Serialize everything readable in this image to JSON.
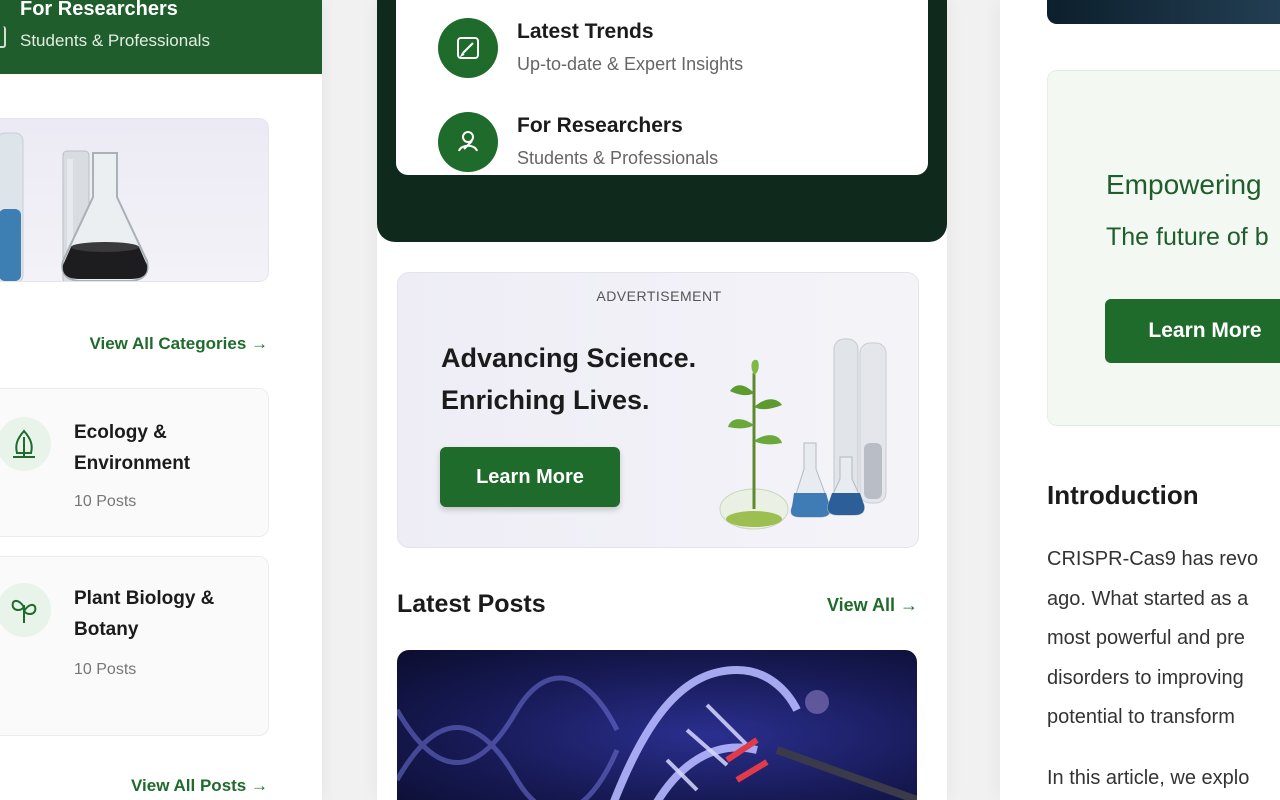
{
  "left": {
    "banner": {
      "title": "For Researchers",
      "subtitle": "Students & Professionals"
    },
    "view_all_categories": "View All Categories →",
    "categories": [
      {
        "title": "Ecology & Environment",
        "count": "10 Posts",
        "icon": "leaf-icon"
      },
      {
        "title": "Plant Biology & Botany",
        "count": "10 Posts",
        "icon": "sprout-icon"
      }
    ],
    "view_all_posts": "View All Posts →"
  },
  "middle": {
    "features": [
      {
        "title": "Latest Trends",
        "subtitle": "Up-to-date & Expert Insights",
        "icon": "pen-icon"
      },
      {
        "title": "For Researchers",
        "subtitle": "Students & Professionals",
        "icon": "researcher-icon"
      }
    ],
    "ad": {
      "label": "ADVERTISEMENT",
      "headline_1": "Advancing Science.",
      "headline_2": "Enriching Lives.",
      "button": "Learn More"
    },
    "latest_posts": {
      "title": "Latest Posts",
      "view_all": "View All →"
    }
  },
  "right": {
    "promo": {
      "heading": "Empowering",
      "subheading": "The future of b",
      "button": "Learn More"
    },
    "intro": {
      "heading": "Introduction",
      "lines": [
        "CRISPR-Cas9 has revo",
        "ago. What started as a",
        "most powerful and pre",
        "disorders to improving",
        "potential to transform"
      ],
      "next_line": "In this article, we explo"
    }
  },
  "colors": {
    "brand_green": "#1f6b2c",
    "dark_green": "#0f2a1c",
    "banner_green": "#1f5e2c"
  }
}
